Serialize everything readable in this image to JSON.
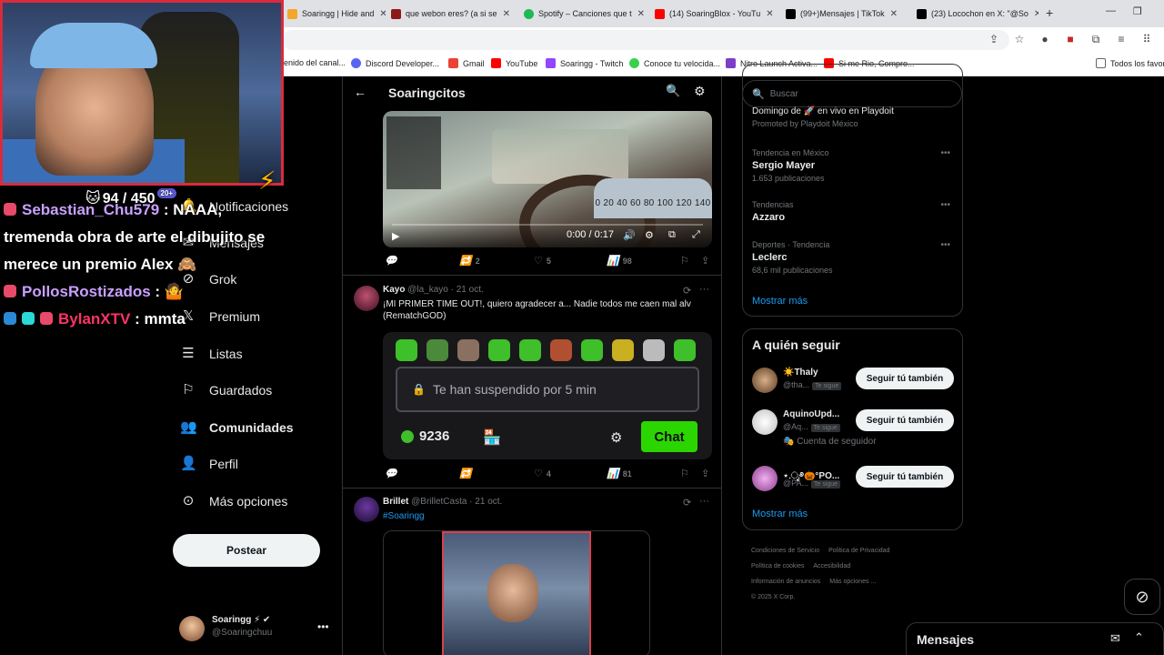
{
  "browser": {
    "tabs": [
      {
        "label": "Soaringg | Hide and ",
        "color": "#f4a62a"
      },
      {
        "label": "que webon eres? (a si se ",
        "color": "#8b1a1a"
      },
      {
        "label": "Spotify – Canciones que t",
        "color": "#1db954"
      },
      {
        "label": "(14) SoaringBlox - YouTu",
        "color": "#ff0000"
      },
      {
        "label": "(99+)Mensajes | TikTok",
        "color": "#000000"
      },
      {
        "label": "(23) Locochon en X: \"@So",
        "color": "#000000"
      }
    ],
    "bookmarks": [
      {
        "label": "enido del canal...",
        "color": "#cccccc"
      },
      {
        "label": "Discord Developer...",
        "color": "#5865f2"
      },
      {
        "label": "Gmail",
        "color": "#ea4335"
      },
      {
        "label": "YouTube",
        "color": "#ff0000"
      },
      {
        "label": "Soaringg - Twitch",
        "color": "#9146ff"
      },
      {
        "label": "Conoce tu velocida...",
        "color": "#3ccf4e"
      },
      {
        "label": "Nitro Launch Activa...",
        "color": "#7a3fc6"
      },
      {
        "label": "Si me Rio, Compro...",
        "color": "#ff0000"
      },
      {
        "label": "Todos los favori",
        "color": "#888888"
      }
    ]
  },
  "nav": {
    "items": [
      {
        "label": "Notificaciones",
        "icon": "bell-icon",
        "glyph": "🔔"
      },
      {
        "label": "Mensajes",
        "icon": "mail-icon",
        "glyph": "✉"
      },
      {
        "label": "Grok",
        "icon": "grok-icon",
        "glyph": "⊘"
      },
      {
        "label": "Premium",
        "icon": "x-logo-icon",
        "glyph": "𝕏"
      },
      {
        "label": "Listas",
        "icon": "list-icon",
        "glyph": "☰"
      },
      {
        "label": "Guardados",
        "icon": "bookmark-icon",
        "glyph": "🔖"
      },
      {
        "label": "Comunidades",
        "icon": "communities-icon",
        "glyph": "👥"
      },
      {
        "label": "Perfil",
        "icon": "person-icon",
        "glyph": "👤"
      },
      {
        "label": "Más opciones",
        "icon": "more-circle-icon",
        "glyph": "⊙"
      }
    ],
    "post_label": "Postear",
    "account": {
      "name": "Soaringg ⚡ ✔",
      "handle": "@Soaringchuu"
    }
  },
  "main": {
    "title": "Soaringcitos",
    "video": {
      "time": "0:00 / 0:17",
      "gauge": "0 20 40 60 80 100 120 140"
    },
    "tweet1_actions": {
      "replies": "",
      "reposts": "2",
      "likes": "5",
      "views": "98"
    },
    "tweet2": {
      "name": "Kayo",
      "handle": "@la_kayo · 21 oct.",
      "text": "¡MI PRIMER TIME OUT!, quiero agradecer a... Nadie todos me caen mal alv (RematchGOD)",
      "chat": {
        "suspend_text": "Te han suspendido por 5 min",
        "points": "9236",
        "chat_label": "Chat"
      },
      "actions": {
        "replies": "",
        "reposts": "",
        "likes": "4",
        "views": "81"
      }
    },
    "tweet3": {
      "name": "Brillet",
      "handle": "@BrilletCasta · 21 oct.",
      "text": "#Soaringg"
    }
  },
  "right": {
    "search_placeholder": "Buscar",
    "trends": [
      {
        "meta": "Domingo de 🚀 en vivo en Playdoit",
        "name": "",
        "count": "Promoted by Playdoit México"
      },
      {
        "meta": "Tendencia en México",
        "name": "Sergio Mayer",
        "count": "1.653 publicaciones"
      },
      {
        "meta": "Tendencias",
        "name": "Azzaro",
        "count": ""
      },
      {
        "meta": "Deportes · Tendencia",
        "name": "Leclerc",
        "count": "68,6 mil publicaciones"
      }
    ],
    "show_more": "Mostrar más",
    "follow_title": "A quién seguir",
    "follow": [
      {
        "name": "☀️Thaly",
        "handle": "@tha...",
        "badge": "Te sigue",
        "sub": "",
        "color": "#c9a27a"
      },
      {
        "name": "AquinoUpd...",
        "handle": "@Aq...",
        "badge": "Te sigue",
        "sub": "Cuenta de seguidor",
        "color": "#f2f2f2"
      },
      {
        "name": "⋆.ೃ࿔🎃°PO...",
        "handle": "@PA...",
        "badge": "Te sigue",
        "sub": "",
        "color": "#d88ad8"
      }
    ],
    "follow_btn": "Seguir tú también",
    "show_more_2": "Mostrar más",
    "footer": [
      "Condiciones de Servicio",
      "Política de Privacidad",
      "Política de cookies",
      "Accesibilidad",
      "Información de anuncios",
      "Más opciones ...",
      "© 2025 X Corp."
    ],
    "messages_label": "Mensajes"
  },
  "overlay": {
    "viewers": "94 / 450",
    "viewers_badge": "20+",
    "chat": [
      {
        "user": "Sebastian_Chu579",
        "msg": ": NAAA, tremenda obra de arte el dibujito se merece un premio Alex 🙈"
      },
      {
        "user": "PollosRostizados",
        "msg": ": 🤷"
      },
      {
        "user": "BylanXTV",
        "msg": ": mmta"
      }
    ]
  }
}
